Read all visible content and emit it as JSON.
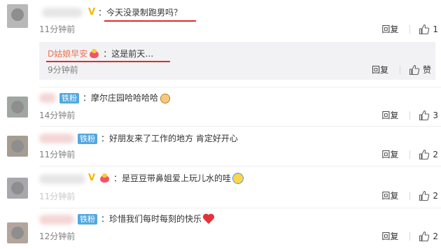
{
  "comments": [
    {
      "text": "：今天没录制跑男吗？",
      "time": "11分钟前",
      "reply_label": "回复",
      "likes": "1"
    },
    {
      "username": "D姑娘早安",
      "text": "：这是前天…",
      "time": "9分钟前",
      "reply_label": "回复",
      "likes": "赞"
    },
    {
      "badge": "铁粉",
      "text": "：摩尔庄园哈哈哈哈",
      "time": "14分钟前",
      "reply_label": "回复",
      "likes": "3"
    },
    {
      "badge": "铁粉",
      "text": "：好朋友来了工作的地方 肯定好开心",
      "time": "11分钟前",
      "reply_label": "回复",
      "likes": "2"
    },
    {
      "text": "：是豆豆带鼻姐爱上玩儿水的哇",
      "time": "11分钟前",
      "reply_label": "回复",
      "likes": "2"
    },
    {
      "badge": "铁粉",
      "text": "：珍惜我们每时每刻的快乐",
      "time": "12分钟前",
      "reply_label": "回复",
      "likes": "2"
    }
  ],
  "icons": {
    "vip": "vip-v-icon",
    "crown": "member-crown-icon",
    "thumb": "thumbs-up-icon"
  },
  "colors": {
    "username": "#eb7350",
    "badge_bg": "#53a7e0",
    "vip": "#f7b500",
    "underline": "#e02a2a",
    "nested_bg": "#f2f2f5"
  }
}
